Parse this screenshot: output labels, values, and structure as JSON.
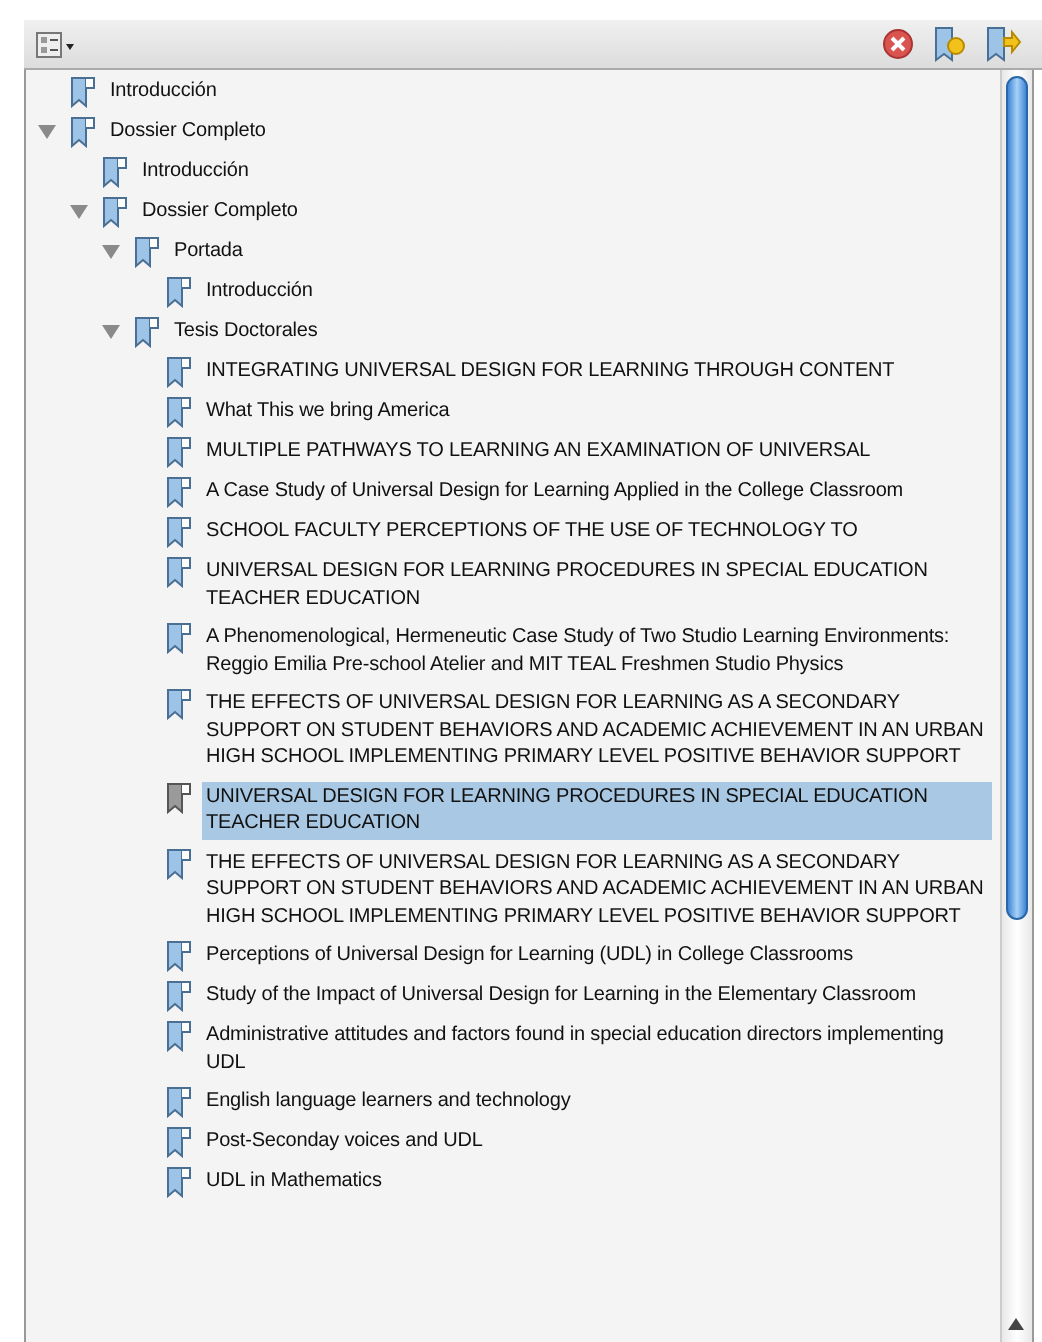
{
  "bookmarks": [
    {
      "label": "Introducción",
      "selected": false
    },
    {
      "label": "Dossier Completo",
      "expanded": true,
      "selected": false,
      "children": [
        {
          "label": "Introducción",
          "selected": false
        },
        {
          "label": "Dossier Completo",
          "expanded": true,
          "selected": false,
          "children": [
            {
              "label": "Portada",
              "expanded": true,
              "selected": false,
              "children": [
                {
                  "label": "Introducción",
                  "selected": false
                }
              ]
            },
            {
              "label": "Tesis Doctorales",
              "expanded": true,
              "selected": false,
              "children": [
                {
                  "label": "INTEGRATING UNIVERSAL DESIGN FOR LEARNING THROUGH CONTENT",
                  "selected": false
                },
                {
                  "label": "What This we bring America",
                  "selected": false
                },
                {
                  "label": "MULTIPLE PATHWAYS TO LEARNING AN EXAMINATION OF UNIVERSAL",
                  "selected": false
                },
                {
                  "label": "A Case Study of Universal Design for Learning Applied in the College Classroom",
                  "selected": false
                },
                {
                  "label": "SCHOOL FACULTY PERCEPTIONS OF THE USE OF TECHNOLOGY TO",
                  "selected": false
                },
                {
                  "label": "UNIVERSAL DESIGN FOR LEARNING PROCEDURES IN SPECIAL EDUCATION TEACHER EDUCATION",
                  "selected": false
                },
                {
                  "label": "A Phenomenological, Hermeneutic Case Study of Two Studio Learning Environments: Reggio Emilia Pre-school Atelier and MIT TEAL Freshmen Studio Physics",
                  "selected": false
                },
                {
                  "label": "THE EFFECTS OF UNIVERSAL DESIGN FOR LEARNING AS A SECONDARY SUPPORT ON STUDENT BEHAVIORS AND ACADEMIC ACHIEVEMENT IN AN URBAN HIGH SCHOOL IMPLEMENTING PRIMARY LEVEL POSITIVE BEHAVIOR SUPPORT",
                  "selected": false
                },
                {
                  "label": "UNIVERSAL DESIGN FOR LEARNING PROCEDURES IN SPECIAL EDUCATION TEACHER EDUCATION",
                  "selected": true
                },
                {
                  "label": "THE EFFECTS OF UNIVERSAL DESIGN FOR LEARNING AS A SECONDARY SUPPORT ON STUDENT BEHAVIORS AND ACADEMIC ACHIEVEMENT IN AN URBAN HIGH SCHOOL IMPLEMENTING PRIMARY LEVEL POSITIVE BEHAVIOR SUPPORT",
                  "selected": false
                },
                {
                  "label": "Perceptions of Universal Design for Learning (UDL) in College Classrooms",
                  "selected": false
                },
                {
                  "label": "Study of the Impact of Universal Design for Learning in the Elementary Classroom",
                  "selected": false
                },
                {
                  "label": "Administrative attitudes and factors found in special education directors implementing UDL",
                  "selected": false
                },
                {
                  "label": "English language learners and technology",
                  "selected": false
                },
                {
                  "label": "Post-Seconday voices and UDL",
                  "selected": false
                },
                {
                  "label": "UDL in Mathematics",
                  "selected": false
                }
              ]
            }
          ]
        }
      ]
    }
  ]
}
